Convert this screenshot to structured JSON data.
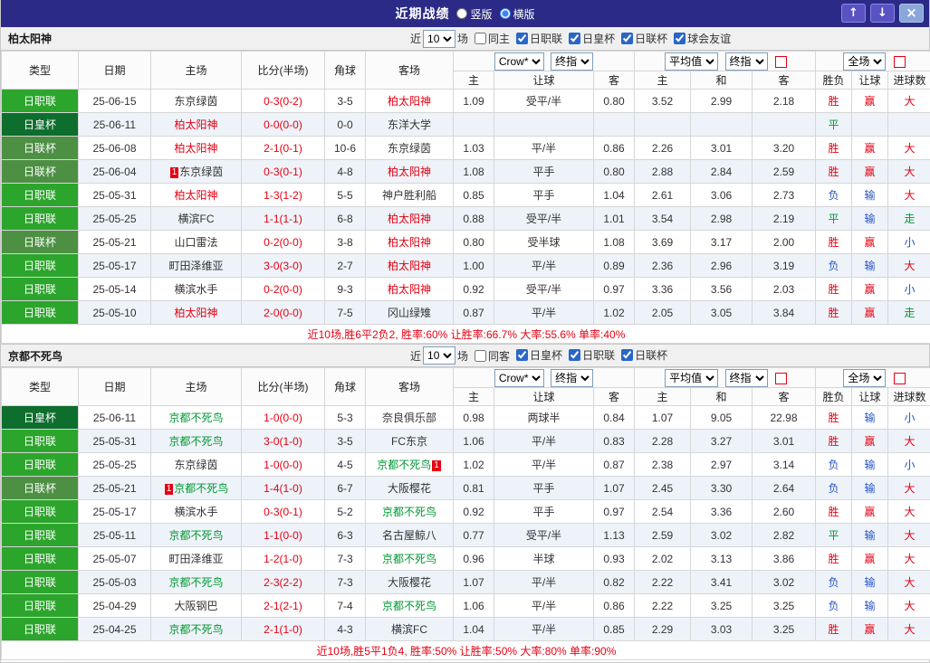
{
  "titlebar": {
    "title": "近期战绩",
    "radios": [
      {
        "label": "竖版",
        "checked": false
      },
      {
        "label": "横版",
        "checked": true
      }
    ],
    "up_icon": "↑",
    "down_icon": "↓",
    "close_icon": "×"
  },
  "controls": {
    "near_label": "近",
    "games_label": "场",
    "count": "10",
    "bookmaker_select": "Crow*",
    "final_select": "终指",
    "average_select": "平均值",
    "scope_select": "全场"
  },
  "headers": {
    "type": "类型",
    "date": "日期",
    "home": "主场",
    "score": "比分(半场)",
    "corner": "角球",
    "away": "客场",
    "odds_home": "主",
    "odds_handicap": "让球",
    "odds_away": "客",
    "avg_home": "主",
    "avg_draw": "和",
    "avg_away": "客",
    "result_wdl": "胜负",
    "result_handicap": "让球",
    "result_goals": "进球数"
  },
  "league_colors": {
    "日职联": "#2ca52c",
    "日皇杯": "#0d6e2d",
    "日联杯": "#4d9044"
  },
  "result_colors": {
    "胜": "#e60012",
    "平": "#009933",
    "负": "#2653c7",
    "赢": "#e60012",
    "走": "#009933",
    "输": "#2653c7",
    "大": "#e60012",
    "小": "#2653c7"
  },
  "score_color": "#e60012",
  "sections": [
    {
      "team": "柏太阳神",
      "team_color": "#e60012",
      "same_side_label": "同主",
      "same_side_checked": false,
      "leagues": [
        {
          "label": "日职联",
          "checked": true
        },
        {
          "label": "日皇杯",
          "checked": true
        },
        {
          "label": "日联杯",
          "checked": true
        },
        {
          "label": "球会友谊",
          "checked": true
        }
      ],
      "summary": "近10场,胜6平2负2, 胜率:60% 让胜率:66.7% 大率:55.6% 单率:40%",
      "rows": [
        {
          "type": "日职联",
          "date": "25-06-15",
          "home": "东京绿茵",
          "home_focus": false,
          "home_card": "",
          "score": "0-3(0-2)",
          "corner": "3-5",
          "away": "柏太阳神",
          "away_focus": true,
          "away_card": "",
          "odds": [
            "1.09",
            "受平/半",
            "0.80"
          ],
          "avg": [
            "3.52",
            "2.99",
            "2.18"
          ],
          "results": [
            "胜",
            "赢",
            "大"
          ]
        },
        {
          "type": "日皇杯",
          "date": "25-06-11",
          "home": "柏太阳神",
          "home_focus": true,
          "home_card": "",
          "score": "0-0(0-0)",
          "corner": "0-0",
          "away": "东洋大学",
          "away_focus": false,
          "away_card": "",
          "odds": [
            "",
            "",
            ""
          ],
          "avg": [
            "",
            "",
            ""
          ],
          "results": [
            "平",
            "",
            ""
          ]
        },
        {
          "type": "日联杯",
          "date": "25-06-08",
          "home": "柏太阳神",
          "home_focus": true,
          "home_card": "",
          "score": "2-1(0-1)",
          "corner": "10-6",
          "away": "东京绿茵",
          "away_focus": false,
          "away_card": "",
          "odds": [
            "1.03",
            "平/半",
            "0.86"
          ],
          "avg": [
            "2.26",
            "3.01",
            "3.20"
          ],
          "results": [
            "胜",
            "赢",
            "大"
          ]
        },
        {
          "type": "日联杯",
          "date": "25-06-04",
          "home": "东京绿茵",
          "home_focus": false,
          "home_card": "1",
          "score": "0-3(0-1)",
          "corner": "4-8",
          "away": "柏太阳神",
          "away_focus": true,
          "away_card": "",
          "odds": [
            "1.08",
            "平手",
            "0.80"
          ],
          "avg": [
            "2.88",
            "2.84",
            "2.59"
          ],
          "results": [
            "胜",
            "赢",
            "大"
          ]
        },
        {
          "type": "日职联",
          "date": "25-05-31",
          "home": "柏太阳神",
          "home_focus": true,
          "home_card": "",
          "score": "1-3(1-2)",
          "corner": "5-5",
          "away": "神户胜利船",
          "away_focus": false,
          "away_card": "",
          "odds": [
            "0.85",
            "平手",
            "1.04"
          ],
          "avg": [
            "2.61",
            "3.06",
            "2.73"
          ],
          "results": [
            "负",
            "输",
            "大"
          ]
        },
        {
          "type": "日职联",
          "date": "25-05-25",
          "home": "横滨FC",
          "home_focus": false,
          "home_card": "",
          "score": "1-1(1-1)",
          "corner": "6-8",
          "away": "柏太阳神",
          "away_focus": true,
          "away_card": "",
          "odds": [
            "0.88",
            "受平/半",
            "1.01"
          ],
          "avg": [
            "3.54",
            "2.98",
            "2.19"
          ],
          "results": [
            "平",
            "输",
            "走"
          ]
        },
        {
          "type": "日联杯",
          "date": "25-05-21",
          "home": "山口雷法",
          "home_focus": false,
          "home_card": "",
          "score": "0-2(0-0)",
          "corner": "3-8",
          "away": "柏太阳神",
          "away_focus": true,
          "away_card": "",
          "odds": [
            "0.80",
            "受半球",
            "1.08"
          ],
          "avg": [
            "3.69",
            "3.17",
            "2.00"
          ],
          "results": [
            "胜",
            "赢",
            "小"
          ]
        },
        {
          "type": "日职联",
          "date": "25-05-17",
          "home": "町田泽维亚",
          "home_focus": false,
          "home_card": "",
          "score": "3-0(3-0)",
          "corner": "2-7",
          "away": "柏太阳神",
          "away_focus": true,
          "away_card": "",
          "odds": [
            "1.00",
            "平/半",
            "0.89"
          ],
          "avg": [
            "2.36",
            "2.96",
            "3.19"
          ],
          "results": [
            "负",
            "输",
            "大"
          ]
        },
        {
          "type": "日职联",
          "date": "25-05-14",
          "home": "横滨水手",
          "home_focus": false,
          "home_card": "",
          "score": "0-2(0-0)",
          "corner": "9-3",
          "away": "柏太阳神",
          "away_focus": true,
          "away_card": "",
          "odds": [
            "0.92",
            "受平/半",
            "0.97"
          ],
          "avg": [
            "3.36",
            "3.56",
            "2.03"
          ],
          "results": [
            "胜",
            "赢",
            "小"
          ]
        },
        {
          "type": "日职联",
          "date": "25-05-10",
          "home": "柏太阳神",
          "home_focus": true,
          "home_card": "",
          "score": "2-0(0-0)",
          "corner": "7-5",
          "away": "冈山绿雉",
          "away_focus": false,
          "away_card": "",
          "odds": [
            "0.87",
            "平/半",
            "1.02"
          ],
          "avg": [
            "2.05",
            "3.05",
            "3.84"
          ],
          "results": [
            "胜",
            "赢",
            "走"
          ]
        }
      ]
    },
    {
      "team": "京都不死鸟",
      "team_color": "#009933",
      "same_side_label": "同客",
      "same_side_checked": false,
      "leagues": [
        {
          "label": "日皇杯",
          "checked": true
        },
        {
          "label": "日职联",
          "checked": true
        },
        {
          "label": "日联杯",
          "checked": true
        }
      ],
      "summary": "近10场,胜5平1负4, 胜率:50% 让胜率:50% 大率:80% 单率:90%",
      "rows": [
        {
          "type": "日皇杯",
          "date": "25-06-11",
          "home": "京都不死鸟",
          "home_focus": true,
          "home_card": "",
          "score": "1-0(0-0)",
          "corner": "5-3",
          "away": "奈良俱乐部",
          "away_focus": false,
          "away_card": "",
          "odds": [
            "0.98",
            "两球半",
            "0.84"
          ],
          "avg": [
            "1.07",
            "9.05",
            "22.98"
          ],
          "results": [
            "胜",
            "输",
            "小"
          ]
        },
        {
          "type": "日职联",
          "date": "25-05-31",
          "home": "京都不死鸟",
          "home_focus": true,
          "home_card": "",
          "score": "3-0(1-0)",
          "corner": "3-5",
          "away": "FC东京",
          "away_focus": false,
          "away_card": "",
          "odds": [
            "1.06",
            "平/半",
            "0.83"
          ],
          "avg": [
            "2.28",
            "3.27",
            "3.01"
          ],
          "results": [
            "胜",
            "赢",
            "大"
          ]
        },
        {
          "type": "日职联",
          "date": "25-05-25",
          "home": "东京绿茵",
          "home_focus": false,
          "home_card": "",
          "score": "1-0(0-0)",
          "corner": "4-5",
          "away": "京都不死鸟",
          "away_focus": true,
          "away_card": "1",
          "odds": [
            "1.02",
            "平/半",
            "0.87"
          ],
          "avg": [
            "2.38",
            "2.97",
            "3.14"
          ],
          "results": [
            "负",
            "输",
            "小"
          ]
        },
        {
          "type": "日联杯",
          "date": "25-05-21",
          "home": "京都不死鸟",
          "home_focus": true,
          "home_card": "1",
          "score": "1-4(1-0)",
          "corner": "6-7",
          "away": "大阪樱花",
          "away_focus": false,
          "away_card": "",
          "odds": [
            "0.81",
            "平手",
            "1.07"
          ],
          "avg": [
            "2.45",
            "3.30",
            "2.64"
          ],
          "results": [
            "负",
            "输",
            "大"
          ]
        },
        {
          "type": "日职联",
          "date": "25-05-17",
          "home": "横滨水手",
          "home_focus": false,
          "home_card": "",
          "score": "0-3(0-1)",
          "corner": "5-2",
          "away": "京都不死鸟",
          "away_focus": true,
          "away_card": "",
          "odds": [
            "0.92",
            "平手",
            "0.97"
          ],
          "avg": [
            "2.54",
            "3.36",
            "2.60"
          ],
          "results": [
            "胜",
            "赢",
            "大"
          ]
        },
        {
          "type": "日职联",
          "date": "25-05-11",
          "home": "京都不死鸟",
          "home_focus": true,
          "home_card": "",
          "score": "1-1(0-0)",
          "corner": "6-3",
          "away": "名古屋鲸八",
          "away_focus": false,
          "away_card": "",
          "odds": [
            "0.77",
            "受平/半",
            "1.13"
          ],
          "avg": [
            "2.59",
            "3.02",
            "2.82"
          ],
          "results": [
            "平",
            "输",
            "大"
          ]
        },
        {
          "type": "日职联",
          "date": "25-05-07",
          "home": "町田泽维亚",
          "home_focus": false,
          "home_card": "",
          "score": "1-2(1-0)",
          "corner": "7-3",
          "away": "京都不死鸟",
          "away_focus": true,
          "away_card": "",
          "odds": [
            "0.96",
            "半球",
            "0.93"
          ],
          "avg": [
            "2.02",
            "3.13",
            "3.86"
          ],
          "results": [
            "胜",
            "赢",
            "大"
          ]
        },
        {
          "type": "日职联",
          "date": "25-05-03",
          "home": "京都不死鸟",
          "home_focus": true,
          "home_card": "",
          "score": "2-3(2-2)",
          "corner": "7-3",
          "away": "大阪樱花",
          "away_focus": false,
          "away_card": "",
          "odds": [
            "1.07",
            "平/半",
            "0.82"
          ],
          "avg": [
            "2.22",
            "3.41",
            "3.02"
          ],
          "results": [
            "负",
            "输",
            "大"
          ]
        },
        {
          "type": "日职联",
          "date": "25-04-29",
          "home": "大阪钢巴",
          "home_focus": false,
          "home_card": "",
          "score": "2-1(2-1)",
          "corner": "7-4",
          "away": "京都不死鸟",
          "away_focus": true,
          "away_card": "",
          "odds": [
            "1.06",
            "平/半",
            "0.86"
          ],
          "avg": [
            "2.22",
            "3.25",
            "3.25"
          ],
          "results": [
            "负",
            "输",
            "大"
          ]
        },
        {
          "type": "日职联",
          "date": "25-04-25",
          "home": "京都不死鸟",
          "home_focus": true,
          "home_card": "",
          "score": "2-1(1-0)",
          "corner": "4-3",
          "away": "横滨FC",
          "away_focus": false,
          "away_card": "",
          "odds": [
            "1.04",
            "平/半",
            "0.85"
          ],
          "avg": [
            "2.29",
            "3.03",
            "3.25"
          ],
          "results": [
            "胜",
            "赢",
            "大"
          ]
        }
      ]
    }
  ]
}
